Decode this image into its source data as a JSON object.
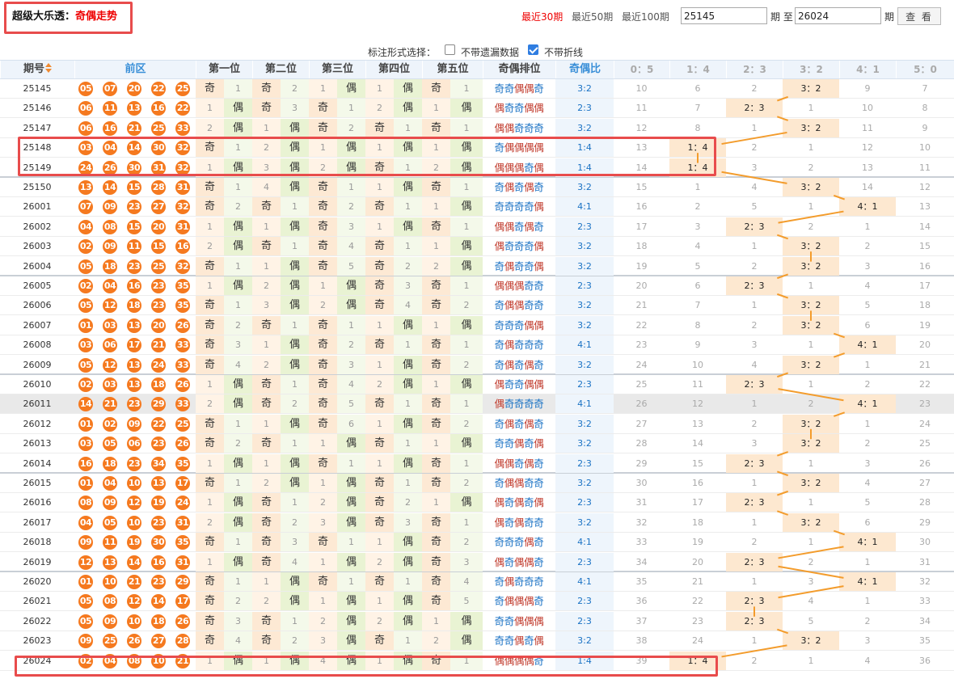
{
  "title": {
    "prefix": "超级大乐透：",
    "highlight": "奇偶走势"
  },
  "periods": [
    {
      "label": "最近30期",
      "active": true
    },
    {
      "label": "最近50期",
      "active": false
    },
    {
      "label": "最近100期",
      "active": false
    }
  ],
  "range": {
    "from": "25145",
    "to": "26024",
    "label_from": "期 至",
    "label_to": "期",
    "button": "查 看"
  },
  "options": {
    "label": "标注形式选择：",
    "items": [
      {
        "label": "不带遗漏数据",
        "checked": false
      },
      {
        "label": "不带折线",
        "checked": true
      }
    ]
  },
  "headers": {
    "issue": "期号",
    "front": "前区",
    "positions": [
      "第一位",
      "第二位",
      "第三位",
      "第四位",
      "第五位"
    ],
    "pattern": "奇偶排位",
    "ratio": "奇偶比",
    "ratio_cols": [
      "0：5",
      "1：4",
      "2：3",
      "3：2",
      "4：1",
      "5：0"
    ]
  },
  "glyphs": {
    "odd": "奇",
    "even": "偶"
  },
  "ratio_labels": [
    "0：5",
    "1：4",
    "2：3",
    "3：2",
    "4：1",
    "5：0"
  ],
  "colors": {
    "ball": "#f5791f",
    "odd_text": "#1a72c4",
    "even_text": "#c0392b",
    "highlight_border": "#e84c4c",
    "trend_line": "#f39c2c"
  },
  "rows": [
    {
      "issue": "25145",
      "balls": [
        "05",
        "07",
        "20",
        "22",
        "25"
      ],
      "pos_miss": [
        [
          null,
          1
        ],
        [
          null,
          2
        ],
        [
          1,
          null
        ],
        [
          1,
          null
        ],
        [
          null,
          1
        ]
      ],
      "pattern": "奇奇偶偶奇",
      "ratio": "3:2",
      "counts": [
        10,
        6,
        2,
        null,
        9,
        7
      ],
      "hit": 3
    },
    {
      "issue": "25146",
      "balls": [
        "06",
        "11",
        "13",
        "16",
        "22"
      ],
      "pos_miss": [
        [
          1,
          null
        ],
        [
          null,
          3
        ],
        [
          null,
          1
        ],
        [
          2,
          null
        ],
        [
          1,
          null
        ]
      ],
      "pattern": "偶奇奇偶偶",
      "ratio": "2:3",
      "counts": [
        11,
        7,
        null,
        1,
        10,
        8
      ],
      "hit": 2
    },
    {
      "issue": "25147",
      "balls": [
        "06",
        "16",
        "21",
        "25",
        "33"
      ],
      "pos_miss": [
        [
          2,
          null
        ],
        [
          1,
          null
        ],
        [
          null,
          2
        ],
        [
          null,
          1
        ],
        [
          null,
          1
        ]
      ],
      "pattern": "偶偶奇奇奇",
      "ratio": "3:2",
      "counts": [
        12,
        8,
        1,
        null,
        11,
        9
      ],
      "hit": 3
    },
    {
      "issue": "25148",
      "balls": [
        "03",
        "04",
        "14",
        "30",
        "32"
      ],
      "pos_miss": [
        [
          null,
          1
        ],
        [
          2,
          null
        ],
        [
          1,
          null
        ],
        [
          1,
          null
        ],
        [
          1,
          null
        ]
      ],
      "pattern": "奇偶偶偶偶",
      "ratio": "1:4",
      "counts": [
        13,
        null,
        2,
        1,
        12,
        10
      ],
      "hit": 1
    },
    {
      "issue": "25149",
      "balls": [
        "24",
        "26",
        "30",
        "31",
        "32"
      ],
      "pos_miss": [
        [
          1,
          null
        ],
        [
          3,
          null
        ],
        [
          2,
          null
        ],
        [
          null,
          1
        ],
        [
          2,
          null
        ]
      ],
      "pattern": "偶偶偶奇偶",
      "ratio": "1:4",
      "counts": [
        14,
        null,
        3,
        2,
        13,
        11
      ],
      "hit": 1
    },
    {
      "issue": "25150",
      "balls": [
        "13",
        "14",
        "15",
        "28",
        "31"
      ],
      "pos_miss": [
        [
          null,
          1
        ],
        [
          4,
          null
        ],
        [
          null,
          1
        ],
        [
          1,
          null
        ],
        [
          null,
          1
        ]
      ],
      "pattern": "奇偶奇偶奇",
      "ratio": "3:2",
      "counts": [
        15,
        1,
        4,
        null,
        14,
        12
      ],
      "hit": 3
    },
    {
      "issue": "26001",
      "balls": [
        "07",
        "09",
        "23",
        "27",
        "32"
      ],
      "pos_miss": [
        [
          null,
          2
        ],
        [
          null,
          1
        ],
        [
          null,
          2
        ],
        [
          null,
          1
        ],
        [
          1,
          null
        ]
      ],
      "pattern": "奇奇奇奇偶",
      "ratio": "4:1",
      "counts": [
        16,
        2,
        5,
        1,
        null,
        13
      ],
      "hit": 4
    },
    {
      "issue": "26002",
      "balls": [
        "04",
        "08",
        "15",
        "20",
        "31"
      ],
      "pos_miss": [
        [
          1,
          null
        ],
        [
          1,
          null
        ],
        [
          null,
          3
        ],
        [
          1,
          null
        ],
        [
          null,
          1
        ]
      ],
      "pattern": "偶偶奇偶奇",
      "ratio": "2:3",
      "counts": [
        17,
        3,
        null,
        2,
        1,
        14
      ],
      "hit": 2
    },
    {
      "issue": "26003",
      "balls": [
        "02",
        "09",
        "11",
        "15",
        "16"
      ],
      "pos_miss": [
        [
          2,
          null
        ],
        [
          null,
          1
        ],
        [
          null,
          4
        ],
        [
          null,
          1
        ],
        [
          1,
          null
        ]
      ],
      "pattern": "偶奇奇奇偶",
      "ratio": "3:2",
      "counts": [
        18,
        4,
        1,
        null,
        2,
        15
      ],
      "hit": 3
    },
    {
      "issue": "26004",
      "balls": [
        "05",
        "18",
        "23",
        "25",
        "32"
      ],
      "pos_miss": [
        [
          null,
          1
        ],
        [
          1,
          null
        ],
        [
          null,
          5
        ],
        [
          null,
          2
        ],
        [
          2,
          null
        ]
      ],
      "pattern": "奇偶奇奇偶",
      "ratio": "3:2",
      "counts": [
        19,
        5,
        2,
        null,
        3,
        16
      ],
      "hit": 3
    },
    {
      "issue": "26005",
      "balls": [
        "02",
        "04",
        "16",
        "23",
        "35"
      ],
      "pos_miss": [
        [
          1,
          null
        ],
        [
          2,
          null
        ],
        [
          1,
          null
        ],
        [
          null,
          3
        ],
        [
          null,
          1
        ]
      ],
      "pattern": "偶偶偶奇奇",
      "ratio": "2:3",
      "counts": [
        20,
        6,
        null,
        1,
        4,
        17
      ],
      "hit": 2
    },
    {
      "issue": "26006",
      "balls": [
        "05",
        "12",
        "18",
        "23",
        "35"
      ],
      "pos_miss": [
        [
          null,
          1
        ],
        [
          3,
          null
        ],
        [
          2,
          null
        ],
        [
          null,
          4
        ],
        [
          null,
          2
        ]
      ],
      "pattern": "奇偶偶奇奇",
      "ratio": "3:2",
      "counts": [
        21,
        7,
        1,
        null,
        5,
        18
      ],
      "hit": 3
    },
    {
      "issue": "26007",
      "balls": [
        "01",
        "03",
        "13",
        "20",
        "26"
      ],
      "pos_miss": [
        [
          null,
          2
        ],
        [
          null,
          1
        ],
        [
          null,
          1
        ],
        [
          1,
          null
        ],
        [
          1,
          null
        ]
      ],
      "pattern": "奇奇奇偶偶",
      "ratio": "3:2",
      "counts": [
        22,
        8,
        2,
        null,
        6,
        19
      ],
      "hit": 3
    },
    {
      "issue": "26008",
      "balls": [
        "03",
        "06",
        "17",
        "21",
        "33"
      ],
      "pos_miss": [
        [
          null,
          3
        ],
        [
          1,
          null
        ],
        [
          null,
          2
        ],
        [
          null,
          1
        ],
        [
          null,
          1
        ]
      ],
      "pattern": "奇偶奇奇奇",
      "ratio": "4:1",
      "counts": [
        23,
        9,
        3,
        1,
        null,
        20
      ],
      "hit": 4
    },
    {
      "issue": "26009",
      "balls": [
        "05",
        "12",
        "13",
        "24",
        "33"
      ],
      "pos_miss": [
        [
          null,
          4
        ],
        [
          2,
          null
        ],
        [
          null,
          3
        ],
        [
          1,
          null
        ],
        [
          null,
          2
        ]
      ],
      "pattern": "奇偶奇偶奇",
      "ratio": "3:2",
      "counts": [
        24,
        10,
        4,
        null,
        1,
        21
      ],
      "hit": 3
    },
    {
      "issue": "26010",
      "balls": [
        "02",
        "03",
        "13",
        "18",
        "26"
      ],
      "pos_miss": [
        [
          1,
          null
        ],
        [
          null,
          1
        ],
        [
          null,
          4
        ],
        [
          2,
          null
        ],
        [
          1,
          null
        ]
      ],
      "pattern": "偶奇奇偶偶",
      "ratio": "2:3",
      "counts": [
        25,
        11,
        null,
        1,
        2,
        22
      ],
      "hit": 2
    },
    {
      "issue": "26011",
      "balls": [
        "14",
        "21",
        "23",
        "29",
        "33"
      ],
      "pos_miss": [
        [
          2,
          null
        ],
        [
          null,
          2
        ],
        [
          null,
          5
        ],
        [
          null,
          1
        ],
        [
          null,
          1
        ]
      ],
      "pattern": "偶奇奇奇奇",
      "ratio": "4:1",
      "counts": [
        26,
        12,
        1,
        2,
        null,
        23
      ],
      "hit": 4
    },
    {
      "issue": "26012",
      "balls": [
        "01",
        "02",
        "09",
        "22",
        "25"
      ],
      "pos_miss": [
        [
          null,
          1
        ],
        [
          1,
          null
        ],
        [
          null,
          6
        ],
        [
          1,
          null
        ],
        [
          null,
          2
        ]
      ],
      "pattern": "奇偶奇偶奇",
      "ratio": "3:2",
      "counts": [
        27,
        13,
        2,
        null,
        1,
        24
      ],
      "hit": 3
    },
    {
      "issue": "26013",
      "balls": [
        "03",
        "05",
        "06",
        "23",
        "26"
      ],
      "pos_miss": [
        [
          null,
          2
        ],
        [
          null,
          1
        ],
        [
          1,
          null
        ],
        [
          null,
          1
        ],
        [
          1,
          null
        ]
      ],
      "pattern": "奇奇偶奇偶",
      "ratio": "3:2",
      "counts": [
        28,
        14,
        3,
        null,
        2,
        25
      ],
      "hit": 3
    },
    {
      "issue": "26014",
      "balls": [
        "16",
        "18",
        "23",
        "34",
        "35"
      ],
      "pos_miss": [
        [
          1,
          null
        ],
        [
          1,
          null
        ],
        [
          null,
          1
        ],
        [
          1,
          null
        ],
        [
          null,
          1
        ]
      ],
      "pattern": "偶偶奇偶奇",
      "ratio": "2:3",
      "counts": [
        29,
        15,
        null,
        1,
        3,
        26
      ],
      "hit": 2
    },
    {
      "issue": "26015",
      "balls": [
        "01",
        "04",
        "10",
        "13",
        "17"
      ],
      "pos_miss": [
        [
          null,
          1
        ],
        [
          2,
          null
        ],
        [
          1,
          null
        ],
        [
          null,
          1
        ],
        [
          null,
          2
        ]
      ],
      "pattern": "奇偶偶奇奇",
      "ratio": "3:2",
      "counts": [
        30,
        16,
        1,
        null,
        4,
        27
      ],
      "hit": 3
    },
    {
      "issue": "26016",
      "balls": [
        "08",
        "09",
        "12",
        "19",
        "24"
      ],
      "pos_miss": [
        [
          1,
          null
        ],
        [
          null,
          1
        ],
        [
          2,
          null
        ],
        [
          null,
          2
        ],
        [
          1,
          null
        ]
      ],
      "pattern": "偶奇偶奇偶",
      "ratio": "2:3",
      "counts": [
        31,
        17,
        null,
        1,
        5,
        28
      ],
      "hit": 2
    },
    {
      "issue": "26017",
      "balls": [
        "04",
        "05",
        "10",
        "23",
        "31"
      ],
      "pos_miss": [
        [
          2,
          null
        ],
        [
          null,
          2
        ],
        [
          3,
          null
        ],
        [
          null,
          3
        ],
        [
          null,
          1
        ]
      ],
      "pattern": "偶奇偶奇奇",
      "ratio": "3:2",
      "counts": [
        32,
        18,
        1,
        null,
        6,
        29
      ],
      "hit": 3
    },
    {
      "issue": "26018",
      "balls": [
        "09",
        "11",
        "19",
        "30",
        "35"
      ],
      "pos_miss": [
        [
          null,
          1
        ],
        [
          null,
          3
        ],
        [
          null,
          1
        ],
        [
          1,
          null
        ],
        [
          null,
          2
        ]
      ],
      "pattern": "奇奇奇偶奇",
      "ratio": "4:1",
      "counts": [
        33,
        19,
        2,
        1,
        null,
        30
      ],
      "hit": 4
    },
    {
      "issue": "26019",
      "balls": [
        "12",
        "13",
        "14",
        "16",
        "31"
      ],
      "pos_miss": [
        [
          1,
          null
        ],
        [
          null,
          4
        ],
        [
          1,
          null
        ],
        [
          2,
          null
        ],
        [
          null,
          3
        ]
      ],
      "pattern": "偶奇偶偶奇",
      "ratio": "2:3",
      "counts": [
        34,
        20,
        null,
        2,
        1,
        31
      ],
      "hit": 2
    },
    {
      "issue": "26020",
      "balls": [
        "01",
        "10",
        "21",
        "23",
        "29"
      ],
      "pos_miss": [
        [
          null,
          1
        ],
        [
          1,
          null
        ],
        [
          null,
          1
        ],
        [
          null,
          1
        ],
        [
          null,
          4
        ]
      ],
      "pattern": "奇偶奇奇奇",
      "ratio": "4:1",
      "counts": [
        35,
        21,
        1,
        3,
        null,
        32
      ],
      "hit": 4
    },
    {
      "issue": "26021",
      "balls": [
        "05",
        "08",
        "12",
        "14",
        "17"
      ],
      "pos_miss": [
        [
          null,
          2
        ],
        [
          2,
          null
        ],
        [
          1,
          null
        ],
        [
          1,
          null
        ],
        [
          null,
          5
        ]
      ],
      "pattern": "奇偶偶偶奇",
      "ratio": "2:3",
      "counts": [
        36,
        22,
        null,
        4,
        1,
        33
      ],
      "hit": 2
    },
    {
      "issue": "26022",
      "balls": [
        "05",
        "09",
        "10",
        "18",
        "26"
      ],
      "pos_miss": [
        [
          null,
          3
        ],
        [
          null,
          1
        ],
        [
          2,
          null
        ],
        [
          2,
          null
        ],
        [
          1,
          null
        ]
      ],
      "pattern": "奇奇偶偶偶",
      "ratio": "2:3",
      "counts": [
        37,
        23,
        null,
        5,
        2,
        34
      ],
      "hit": 2
    },
    {
      "issue": "26023",
      "balls": [
        "09",
        "25",
        "26",
        "27",
        "28"
      ],
      "pos_miss": [
        [
          null,
          4
        ],
        [
          null,
          2
        ],
        [
          3,
          null
        ],
        [
          null,
          1
        ],
        [
          2,
          null
        ]
      ],
      "pattern": "奇奇偶奇偶",
      "ratio": "3:2",
      "counts": [
        38,
        24,
        1,
        null,
        3,
        35
      ],
      "hit": 3
    },
    {
      "issue": "26024",
      "balls": [
        "02",
        "04",
        "08",
        "10",
        "21"
      ],
      "pos_miss": [
        [
          1,
          null
        ],
        [
          1,
          null
        ],
        [
          4,
          null
        ],
        [
          1,
          null
        ],
        [
          null,
          1
        ]
      ],
      "pattern": "偶偶偶偶奇",
      "ratio": "1:4",
      "counts": [
        39,
        null,
        2,
        1,
        4,
        36
      ],
      "hit": 1
    }
  ]
}
